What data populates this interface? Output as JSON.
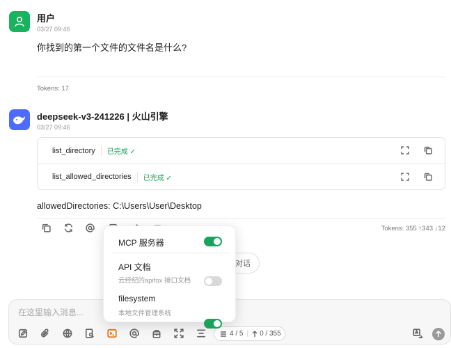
{
  "messages": {
    "user": {
      "name": "用户",
      "time": "03/27 09:46",
      "text": "你找到的第一个文件的文件名是什么?",
      "tokens": "Tokens: 17"
    },
    "assistant": {
      "name": "deepseek-v3-241226 | 火山引擎",
      "time": "03/27 09:46",
      "tools": [
        {
          "name": "list_directory",
          "status": "已完成 ✓"
        },
        {
          "name": "list_allowed_directories",
          "status": "已完成 ✓"
        }
      ],
      "text": "allowedDirectories: C:\\Users\\User\\Desktop",
      "tokens": "Tokens: 355 ↑343 ↓12"
    }
  },
  "hidden_button_tail": "对话",
  "mcp_popup": {
    "items": [
      {
        "title": "MCP 服务器",
        "subtitle": "",
        "enabled": true
      },
      {
        "title": "API 文档",
        "subtitle": "云经纪的apifox 接口文档",
        "enabled": false
      },
      {
        "title": "filesystem",
        "subtitle": "本地文件管理系统",
        "enabled": true
      }
    ]
  },
  "input": {
    "placeholder": "在这里输入消息...",
    "context_count": "4 / 5",
    "token_count": "0 / 355"
  },
  "colors": {
    "accent_green": "#19a35a",
    "deepseek_blue": "#4d6bfe",
    "user_green": "#17b35e"
  }
}
